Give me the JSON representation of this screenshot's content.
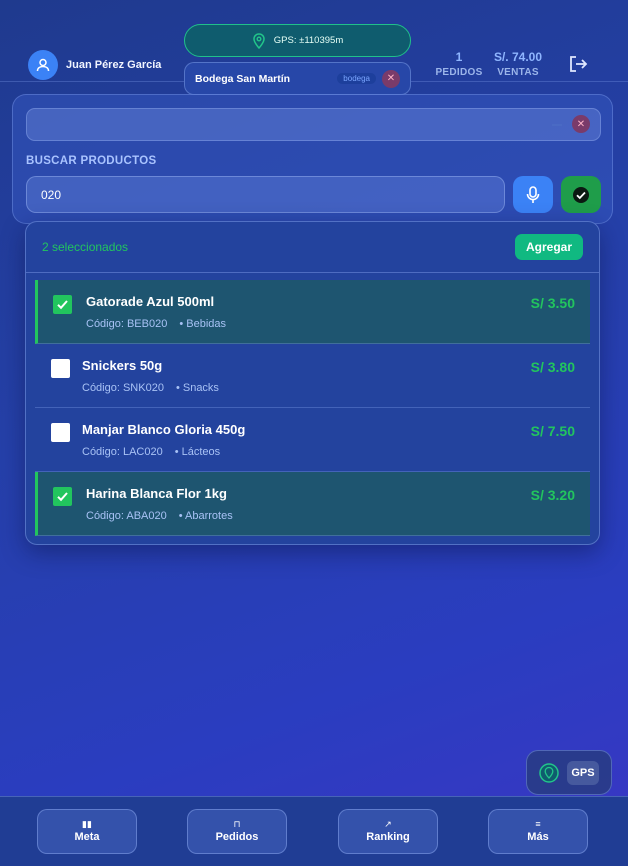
{
  "header": {
    "user_name": "Juan Pérez García",
    "gps_text": "GPS: ±110395m",
    "store": {
      "name": "Bodega San Martín",
      "tag": "bodega"
    },
    "stats": [
      {
        "value": "1",
        "label": "PEDIDOS"
      },
      {
        "value": "S/. 74.00",
        "label": "VENTAS"
      }
    ]
  },
  "search": {
    "label": "BUSCAR PRODUCTOS",
    "query": "020"
  },
  "results": {
    "selected_text": "2 seleccionados",
    "add_label": "Agregar",
    "items": [
      {
        "name": "Gatorade Azul 500ml",
        "code": "Código: BEB020",
        "category": "• Bebidas",
        "price": "S/ 3.50",
        "selected": true
      },
      {
        "name": "Snickers 50g",
        "code": "Código: SNK020",
        "category": "• Snacks",
        "price": "S/ 3.80",
        "selected": false
      },
      {
        "name": "Manjar Blanco Gloria 450g",
        "code": "Código: LAC020",
        "category": "• Lácteos",
        "price": "S/ 7.50",
        "selected": false
      },
      {
        "name": "Harina Blanca Flor 1kg",
        "code": "Código: ABA020",
        "category": "• Abarrotes",
        "price": "S/ 3.20",
        "selected": true
      }
    ]
  },
  "gps_button": {
    "label": "GPS"
  },
  "nav": [
    {
      "label": "Meta",
      "icon": "bar-chart-icon",
      "glyph": "▮▮"
    },
    {
      "label": "Pedidos",
      "icon": "lock-icon",
      "glyph": "⊓"
    },
    {
      "label": "Ranking",
      "icon": "trend-up-icon",
      "glyph": "↗"
    },
    {
      "label": "Más",
      "icon": "menu-icon",
      "glyph": "≡"
    }
  ],
  "colors": {
    "accent_green": "#22c55e",
    "primary_blue": "#3b82f6",
    "bg": "#2540a8"
  }
}
